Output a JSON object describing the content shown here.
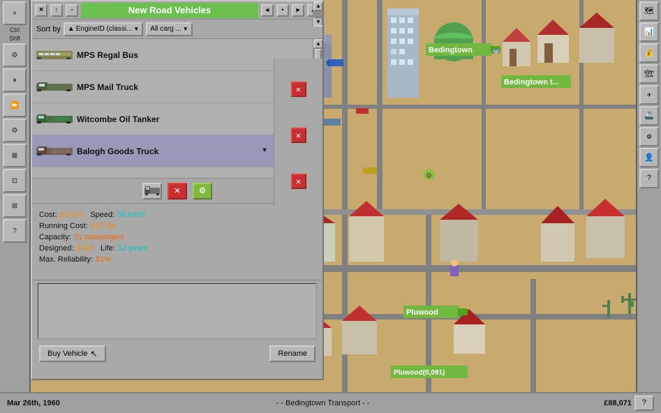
{
  "window": {
    "title": "New Road Vehicles",
    "close_btn": "×",
    "minimize_btn": "−",
    "pin_btn": "↑",
    "expand_btn": "→"
  },
  "sort_bar": {
    "sort_label": "Sort by",
    "sort_field": "EngineID (classi...",
    "cargo_filter": "All carg ...",
    "arrow": "▲"
  },
  "vehicles": [
    {
      "id": 0,
      "name": "MPS Regal Bus",
      "type": "bus",
      "selected": false
    },
    {
      "id": 1,
      "name": "MPS Mail Truck",
      "type": "truck",
      "selected": false
    },
    {
      "id": 2,
      "name": "Witcombe Oil Tanker",
      "type": "truck2",
      "selected": false
    },
    {
      "id": 3,
      "name": "Balogh Goods Truck",
      "type": "truck3",
      "selected": true
    }
  ],
  "vehicle_info": {
    "cost_label": "Cost:",
    "cost_value": "£4,937",
    "speed_label": "Speed:",
    "speed_value": "56 km/h",
    "running_cost_label": "Running Cost:",
    "running_cost_value": "£427/yr",
    "capacity_label": "Capacity:",
    "capacity_value": "31 passengers",
    "designed_label": "Designed:",
    "designed_value": "1929",
    "life_label": "Life:",
    "life_value": "12 years",
    "reliability_label": "Max. Reliability:",
    "reliability_value": "81%"
  },
  "actions": {
    "buy_label": "Buy Vehicle",
    "rename_label": "Rename"
  },
  "status_bar": {
    "date": "Mar 26th, 1960",
    "company": "- - Bedingtown Transport - -",
    "money": "£88,071"
  },
  "map": {
    "town1_label": "Bedingtown",
    "town2_label": "Pluwood",
    "town2_coords": "Pluwood(0,091)"
  },
  "sidebar": {
    "items": [
      "×",
      "Ctrl",
      "Shft",
      "⚙",
      "⏸",
      "⏩",
      "⚙",
      "⊠",
      "⊡",
      "⊞",
      "?"
    ]
  },
  "right_toolbar": {
    "items": [
      "🗺",
      "📊",
      "💰",
      "🏗",
      "✈",
      "🚢",
      "⚙",
      "👤",
      "?"
    ]
  },
  "ctrl_buttons": {
    "truck_icon": "🚚",
    "cross_icon": "✕",
    "gear_icon": "⚙"
  }
}
